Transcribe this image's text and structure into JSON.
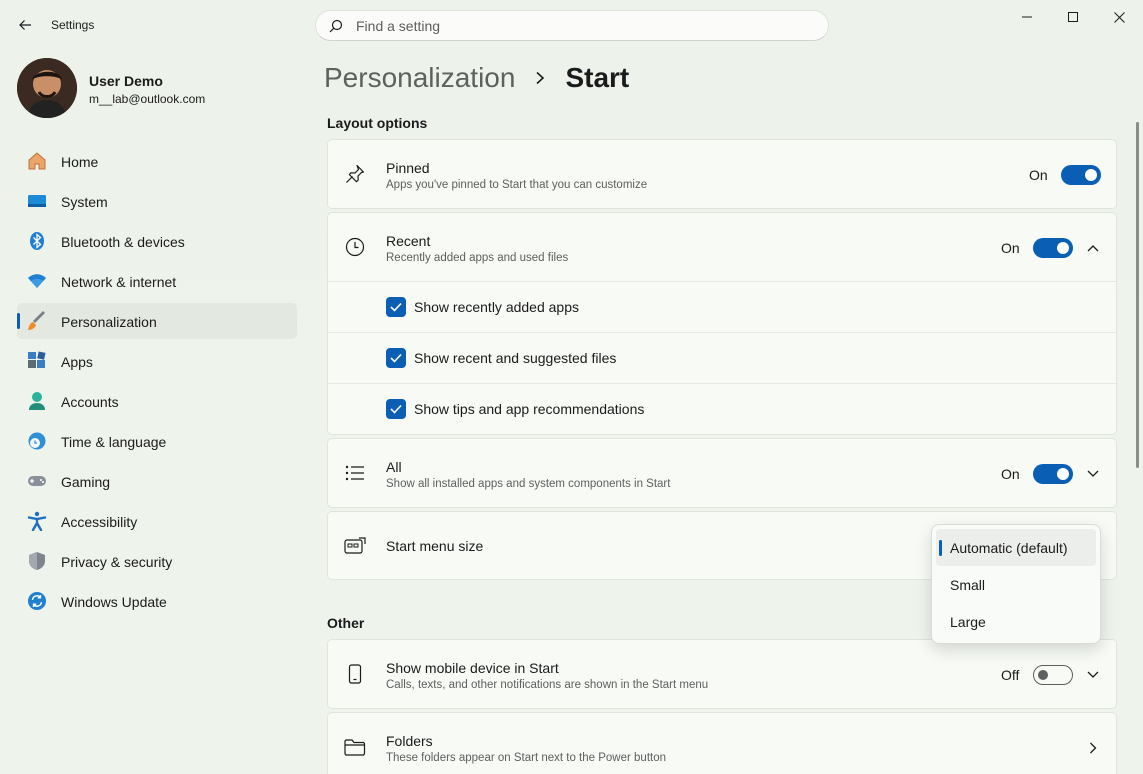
{
  "app": {
    "title": "Settings"
  },
  "search": {
    "placeholder": "Find a setting"
  },
  "profile": {
    "name": "User Demo",
    "email": "m__lab@outlook.com"
  },
  "sidebar": {
    "items": [
      {
        "label": "Home",
        "icon": "home-icon"
      },
      {
        "label": "System",
        "icon": "system-icon"
      },
      {
        "label": "Bluetooth & devices",
        "icon": "bluetooth-icon"
      },
      {
        "label": "Network & internet",
        "icon": "wifi-icon"
      },
      {
        "label": "Personalization",
        "icon": "brush-icon",
        "active": true
      },
      {
        "label": "Apps",
        "icon": "apps-icon"
      },
      {
        "label": "Accounts",
        "icon": "accounts-icon"
      },
      {
        "label": "Time & language",
        "icon": "globe-clock-icon"
      },
      {
        "label": "Gaming",
        "icon": "gamepad-icon"
      },
      {
        "label": "Accessibility",
        "icon": "accessibility-icon"
      },
      {
        "label": "Privacy & security",
        "icon": "shield-icon"
      },
      {
        "label": "Windows Update",
        "icon": "update-icon"
      }
    ]
  },
  "breadcrumb": {
    "parent": "Personalization",
    "current": "Start"
  },
  "layout_options": {
    "title": "Layout options",
    "pinned": {
      "title": "Pinned",
      "subtitle": "Apps you've pinned to Start that you can customize",
      "state": "On"
    },
    "recent": {
      "title": "Recent",
      "subtitle": "Recently added apps and used files",
      "state": "On",
      "options": [
        {
          "label": "Show recently added apps",
          "checked": true
        },
        {
          "label": "Show recent and suggested files",
          "checked": true
        },
        {
          "label": "Show tips and app recommendations",
          "checked": true
        }
      ]
    },
    "all": {
      "title": "All",
      "subtitle": "Show all installed apps and system components in Start",
      "state": "On"
    },
    "menu_size": {
      "title": "Start menu size"
    }
  },
  "size_dropdown": {
    "options": [
      "Automatic (default)",
      "Small",
      "Large"
    ],
    "selected": "Automatic (default)"
  },
  "other": {
    "title": "Other",
    "mobile": {
      "title": "Show mobile device in Start",
      "subtitle": "Calls, texts, and other notifications are shown in the Start menu",
      "state": "Off"
    },
    "folders": {
      "title": "Folders",
      "subtitle": "These folders appear on Start next to the Power button"
    }
  },
  "colors": {
    "accent": "#0a5fb4",
    "background": "#eef3ec",
    "card": "#f7faf5"
  }
}
